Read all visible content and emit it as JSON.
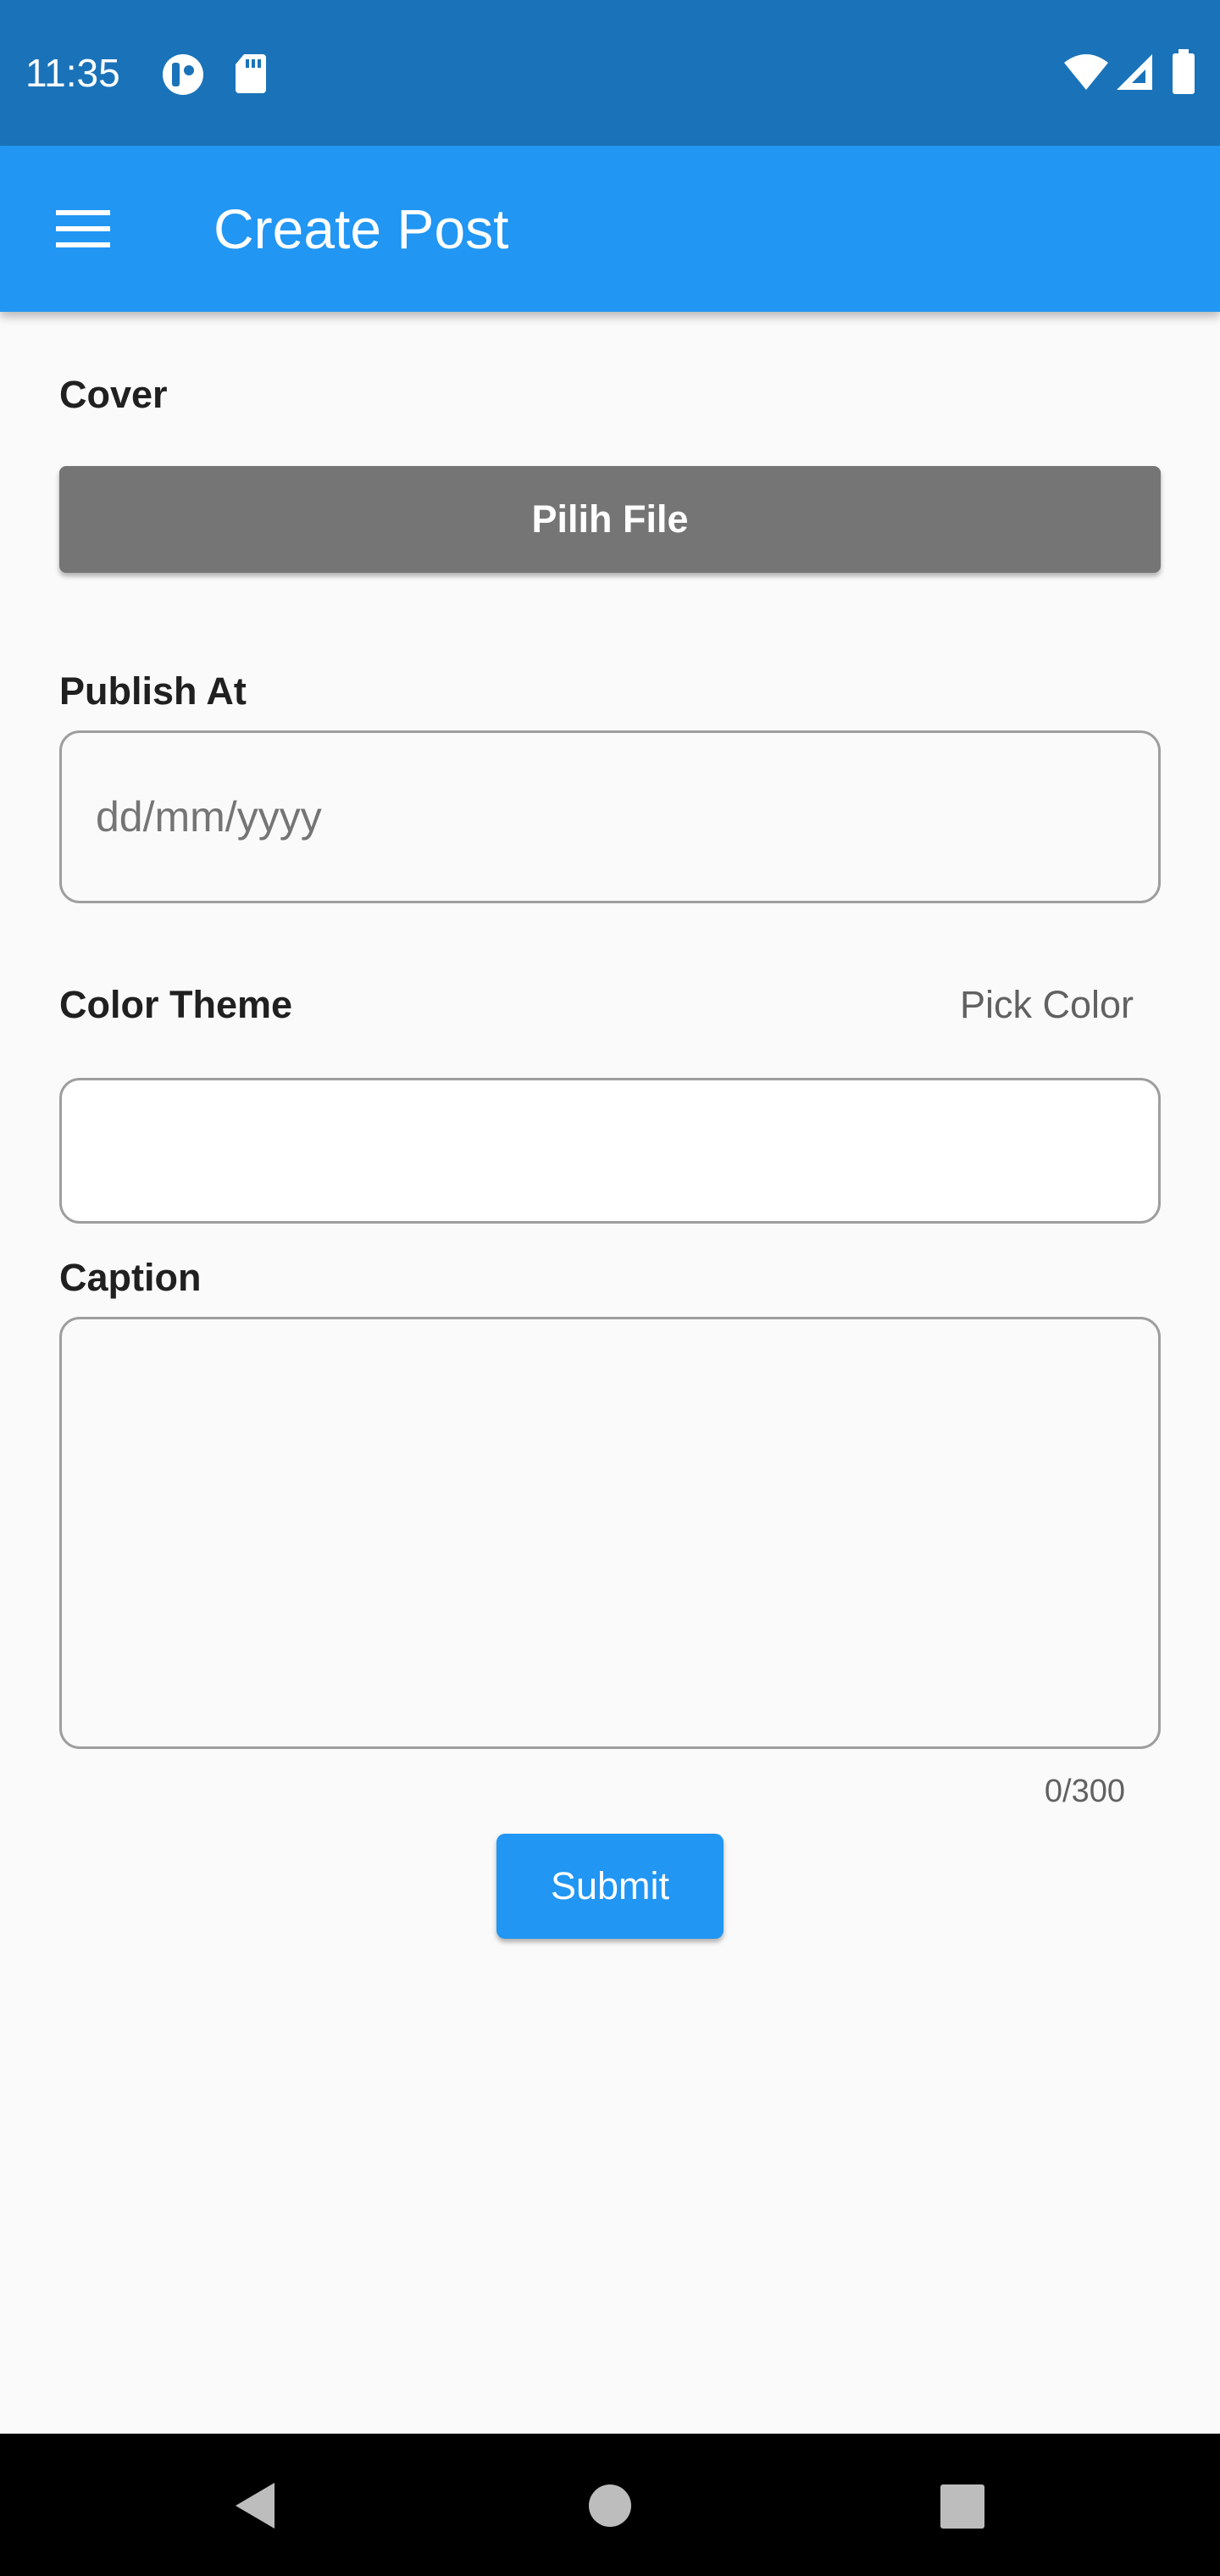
{
  "status_bar": {
    "time": "11:35",
    "icons": [
      "notification-app-icon",
      "sd-card-icon",
      "wifi-icon",
      "cell-signal-icon",
      "battery-icon"
    ]
  },
  "app_bar": {
    "title": "Create Post",
    "menu_icon": "menu-icon",
    "color": "#2196f3"
  },
  "form": {
    "cover_label": "Cover",
    "pick_file_label": "Pilih File",
    "publish_label": "Publish At",
    "publish_placeholder": "dd/mm/yyyy",
    "color_label": "Color Theme",
    "pick_color_label": "Pick Color",
    "caption_label": "Caption",
    "caption_counter": "0/300",
    "submit_label": "Submit"
  },
  "nav_bar": {
    "icons": [
      "back-icon",
      "home-icon",
      "recents-icon"
    ]
  }
}
